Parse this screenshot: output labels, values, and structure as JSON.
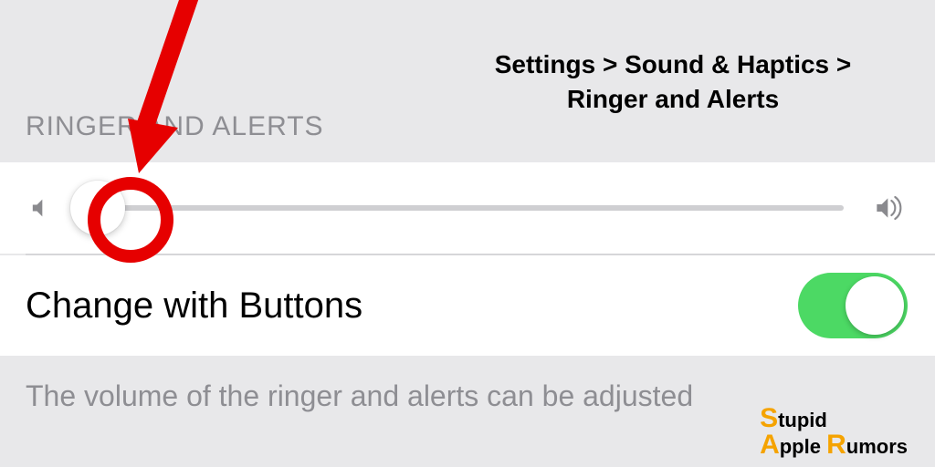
{
  "annotation": {
    "path_text": "Settings > Sound & Haptics > Ringer and Alerts"
  },
  "section": {
    "header": "RINGER AND ALERTS"
  },
  "slider": {
    "value_percent": 6
  },
  "toggle": {
    "label": "Change with Buttons",
    "on": true
  },
  "footer": {
    "text": "The volume of the ringer and alerts can be adjusted"
  },
  "watermark": {
    "line1_big": "S",
    "line1_rest": "tupid",
    "line2_big1": "A",
    "line2_mid": "pple ",
    "line2_big2": "R",
    "line2_rest": "umors"
  }
}
